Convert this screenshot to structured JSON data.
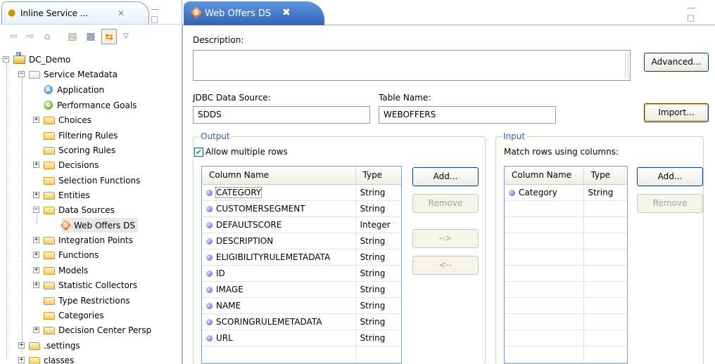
{
  "left_view": {
    "tab_title": "Inline Service ...",
    "tab_close": "✕",
    "window_controls": "— □",
    "toolbar": [
      "back-arrow",
      "forward-arrow",
      "home",
      "collapse-all",
      "link-editor",
      "sync",
      "view-menu"
    ],
    "tree": [
      {
        "label": "DC_Demo",
        "depth": 0,
        "expander": "−",
        "icon": "project-icon"
      },
      {
        "label": "Service Metadata",
        "depth": 1,
        "expander": "−",
        "icon": "metadata-icon"
      },
      {
        "label": "Application",
        "depth": 2,
        "expander": "",
        "icon": "application-icon"
      },
      {
        "label": "Performance Goals",
        "depth": 2,
        "expander": "",
        "icon": "goal-icon"
      },
      {
        "label": "Choices",
        "depth": 2,
        "expander": "+",
        "icon": "folder-icon"
      },
      {
        "label": "Filtering Rules",
        "depth": 2,
        "expander": "",
        "icon": "folder-icon"
      },
      {
        "label": "Scoring Rules",
        "depth": 2,
        "expander": "",
        "icon": "folder-icon"
      },
      {
        "label": "Decisions",
        "depth": 2,
        "expander": "+",
        "icon": "folder-icon"
      },
      {
        "label": "Selection Functions",
        "depth": 2,
        "expander": "",
        "icon": "folder-icon"
      },
      {
        "label": "Entities",
        "depth": 2,
        "expander": "+",
        "icon": "folder-icon"
      },
      {
        "label": "Data Sources",
        "depth": 2,
        "expander": "−",
        "icon": "folder-icon"
      },
      {
        "label": "Web Offers DS",
        "depth": 3,
        "expander": "",
        "icon": "datasource-icon"
      },
      {
        "label": "Integration Points",
        "depth": 2,
        "expander": "+",
        "icon": "folder-icon"
      },
      {
        "label": "Functions",
        "depth": 2,
        "expander": "+",
        "icon": "folder-icon"
      },
      {
        "label": "Models",
        "depth": 2,
        "expander": "+",
        "icon": "folder-icon"
      },
      {
        "label": "Statistic Collectors",
        "depth": 2,
        "expander": "+",
        "icon": "folder-icon"
      },
      {
        "label": "Type Restrictions",
        "depth": 2,
        "expander": "",
        "icon": "folder-icon"
      },
      {
        "label": "Categories",
        "depth": 2,
        "expander": "",
        "icon": "folder-icon"
      },
      {
        "label": "Decision Center Persp",
        "depth": 2,
        "expander": "+",
        "icon": "folder-icon"
      },
      {
        "label": ".settings",
        "depth": 1,
        "expander": "+",
        "icon": "folder-icon"
      },
      {
        "label": "classes",
        "depth": 1,
        "expander": "+",
        "icon": "folder-icon"
      }
    ]
  },
  "editor": {
    "tab_title": "Web Offers DS",
    "tab_close": "✖",
    "window_controls": "— □",
    "description_label": "Description:",
    "description_value": "",
    "advanced_button": "Advanced...",
    "jdbc_label": "JDBC Data Source:",
    "jdbc_value": "SDDS",
    "table_label": "Table Name:",
    "table_value": "WEBOFFERS",
    "import_button": "Import...",
    "output": {
      "title": "Output",
      "allow_multiple_rows": "Allow multiple rows",
      "allow_multiple_rows_checked": true,
      "headers": {
        "name": "Column Name",
        "type": "Type"
      },
      "rows": [
        {
          "name": "CATEGORY",
          "type": "String"
        },
        {
          "name": "CUSTOMERSEGMENT",
          "type": "String"
        },
        {
          "name": "DEFAULTSCORE",
          "type": "Integer"
        },
        {
          "name": "DESCRIPTION",
          "type": "String"
        },
        {
          "name": "ELIGIBILITYRULEMETADATA",
          "type": "String"
        },
        {
          "name": "ID",
          "type": "String"
        },
        {
          "name": "IMAGE",
          "type": "String"
        },
        {
          "name": "NAME",
          "type": "String"
        },
        {
          "name": "SCORINGRULEMETADATA",
          "type": "String"
        },
        {
          "name": "URL",
          "type": "String"
        }
      ],
      "add_button": "Add...",
      "remove_button": "Remove",
      "move_right_button": "-->",
      "move_left_button": "<--"
    },
    "input": {
      "title": "Input",
      "match_label": "Match rows using columns:",
      "headers": {
        "name": "Column Name",
        "type": "Type"
      },
      "rows": [
        {
          "name": "Category",
          "type": "String"
        }
      ],
      "add_button": "Add...",
      "remove_button": "Remove"
    }
  }
}
